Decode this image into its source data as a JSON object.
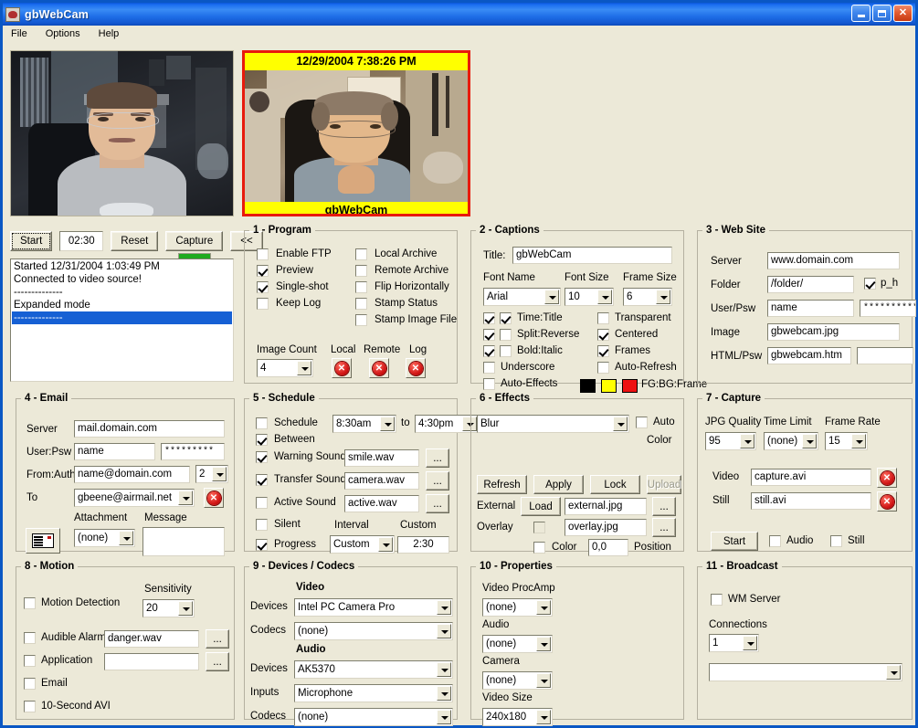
{
  "window": {
    "title": "gbWebCam",
    "icon": "app-icon",
    "buttons": {
      "minimize": "_",
      "maximize": "□",
      "close": "×"
    }
  },
  "menu": {
    "items": [
      "File",
      "Options",
      "Help"
    ]
  },
  "preview": {
    "processed": {
      "timestamp": "12/29/2004 7:38:26 PM",
      "caption": "gbWebCam",
      "frame_color": "#e81a0c",
      "caption_bg": "#ffff00",
      "caption_fg": "#000000"
    }
  },
  "toolbar": {
    "start": "Start",
    "timer": "02:30",
    "reset": "Reset",
    "capture": "Capture",
    "collapse": "<<",
    "progress_percent": 100,
    "progress_color": "#1faa1f"
  },
  "log": {
    "lines": [
      {
        "text": "Started 12/31/2004 1:03:49 PM",
        "selected": false
      },
      {
        "text": "Connected to video source!",
        "selected": false
      },
      {
        "text": "--------------",
        "selected": false
      },
      {
        "text": "Expanded mode",
        "selected": false
      },
      {
        "text": "--------------",
        "selected": true
      }
    ]
  },
  "program": {
    "title": "1 - Program",
    "checks_left": [
      {
        "label": "Enable FTP",
        "checked": false
      },
      {
        "label": "Preview",
        "checked": true
      },
      {
        "label": "Single-shot",
        "checked": true
      },
      {
        "label": "Keep Log",
        "checked": false
      }
    ],
    "checks_right": [
      {
        "label": "Local Archive",
        "checked": false
      },
      {
        "label": "Remote Archive",
        "checked": false
      },
      {
        "label": "Flip Horizontally",
        "checked": false
      },
      {
        "label": "Stamp Status",
        "checked": false
      },
      {
        "label": "Stamp Image File",
        "checked": false
      }
    ],
    "image_count_label": "Image Count",
    "image_count_value": "4",
    "local_label": "Local",
    "remote_label": "Remote",
    "log_label": "Log"
  },
  "captions": {
    "title": "2 - Captions",
    "title_label": "Title:",
    "title_value": "gbWebCam",
    "font_name_label": "Font Name",
    "font_name_value": "Arial",
    "font_size_label": "Font Size",
    "font_size_value": "10",
    "frame_size_label": "Frame Size",
    "frame_size_value": "6",
    "pairs": [
      {
        "label": "Time:Title",
        "a": true,
        "b": true
      },
      {
        "label": "Split:Reverse",
        "a": true,
        "b": false
      },
      {
        "label": "Bold:Italic",
        "a": true,
        "b": false
      }
    ],
    "underscore": {
      "label": "Underscore",
      "checked": false
    },
    "auto_effects": {
      "label": "Auto-Effects",
      "checked": false
    },
    "transparent": {
      "label": "Transparent",
      "checked": false
    },
    "centered": {
      "label": "Centered",
      "checked": true
    },
    "frames": {
      "label": "Frames",
      "checked": true
    },
    "auto_refresh": {
      "label": "Auto-Refresh",
      "checked": false
    },
    "color_label": "FG:BG:Frame",
    "fg_color": "#000000",
    "bg_color": "#ffff00",
    "frame_color": "#ee1111"
  },
  "website": {
    "title": "3 - Web Site",
    "server_label": "Server",
    "server_value": "www.domain.com",
    "folder_label": "Folder",
    "folder_value": "/folder/",
    "ph_label": "p_h",
    "ph_checked": true,
    "userpsw_label": "User/Psw",
    "user_value": "name",
    "psw_value": "***********",
    "image_label": "Image",
    "image_value": "gbwebcam.jpg",
    "html_label": "HTML/Psw",
    "html_value": "gbwebcam.htm",
    "html_psw_value": ""
  },
  "email": {
    "title": "4 - Email",
    "server_label": "Server",
    "server_value": "mail.domain.com",
    "userpsw_label": "User:Psw",
    "user_value": "name",
    "psw_value": "*********",
    "fromauth_label": "From:Auth",
    "from_value": "name@domain.com",
    "auth_value": "2",
    "to_label": "To",
    "to_value": "gbeene@airmail.net",
    "attachment_label": "Attachment",
    "attachment_value": "(none)",
    "message_label": "Message",
    "message_value": "",
    "compose_icon": "envelope-icon"
  },
  "schedule": {
    "title": "5 - Schedule",
    "schedule": {
      "label": "Schedule",
      "checked": false
    },
    "from_time": "8:30am",
    "to_word": "to",
    "to_time": "4:30pm",
    "between": {
      "label": "Between",
      "checked": true
    },
    "warning_sound": {
      "label": "Warning Sound",
      "checked": true,
      "value": "smile.wav"
    },
    "transfer_sound": {
      "label": "Transfer Sound",
      "checked": true,
      "value": "camera.wav"
    },
    "active_sound": {
      "label": "Active Sound",
      "checked": false,
      "value": "active.wav"
    },
    "silent": {
      "label": "Silent",
      "checked": false
    },
    "progress": {
      "label": "Progress",
      "checked": true
    },
    "interval_label": "Interval",
    "interval_value": "Custom",
    "custom_label": "Custom",
    "custom_value": "2:30",
    "browse": "..."
  },
  "effects": {
    "title": "6 - Effects",
    "effect_value": "Blur",
    "auto": {
      "label": "Auto",
      "checked": false
    },
    "color_caption": "Color",
    "refresh": "Refresh",
    "apply": "Apply",
    "lock": "Lock",
    "upload": "Upload",
    "external_label": "External",
    "load": "Load",
    "external_value": "external.jpg",
    "overlay_label": "Overlay",
    "overlay_checked": false,
    "overlay_value": "overlay.jpg",
    "color": {
      "label": "Color",
      "checked": false
    },
    "position_value": "0,0",
    "position_label": "Position",
    "browse": "..."
  },
  "capture": {
    "title": "7 - Capture",
    "jpg_quality_label": "JPG Quality",
    "jpg_quality_value": "95",
    "time_limit_label": "Time Limit",
    "time_limit_value": "(none)",
    "frame_rate_label": "Frame Rate",
    "frame_rate_value": "15",
    "video_label": "Video",
    "video_value": "capture.avi",
    "still_label": "Still",
    "still_value": "still.avi",
    "start": "Start",
    "audio": {
      "label": "Audio",
      "checked": false
    },
    "still_cb": {
      "label": "Still",
      "checked": false
    }
  },
  "motion": {
    "title": "8 - Motion",
    "detection": {
      "label": "Motion Detection",
      "checked": false
    },
    "sensitivity_label": "Sensitivity",
    "sensitivity_value": "20",
    "audible_alarm": {
      "label": "Audible Alarm",
      "checked": false,
      "value": "danger.wav"
    },
    "application": {
      "label": "Application",
      "checked": false,
      "value": ""
    },
    "email": {
      "label": "Email",
      "checked": false
    },
    "avi": {
      "label": "10-Second AVI",
      "checked": false
    },
    "browse": "..."
  },
  "devices": {
    "title": "9 - Devices / Codecs",
    "video_header": "Video",
    "video_devices_label": "Devices",
    "video_devices_value": "Intel PC Camera Pro",
    "video_codecs_label": "Codecs",
    "video_codecs_value": "(none)",
    "audio_header": "Audio",
    "audio_devices_label": "Devices",
    "audio_devices_value": "AK5370",
    "audio_inputs_label": "Inputs",
    "audio_inputs_value": "Microphone",
    "audio_codecs_label": "Codecs",
    "audio_codecs_value": "(none)"
  },
  "properties": {
    "title": "10 - Properties",
    "procamp_label": "Video ProcAmp",
    "procamp_value": "(none)",
    "audio_label": "Audio",
    "audio_value": "(none)",
    "camera_label": "Camera",
    "camera_value": "(none)",
    "video_size_label": "Video Size",
    "video_size_value": "240x180"
  },
  "broadcast": {
    "title": "11 - Broadcast",
    "wm_server": {
      "label": "WM Server",
      "checked": false
    },
    "connections_label": "Connections",
    "connections_value": "1",
    "url_value": ""
  }
}
